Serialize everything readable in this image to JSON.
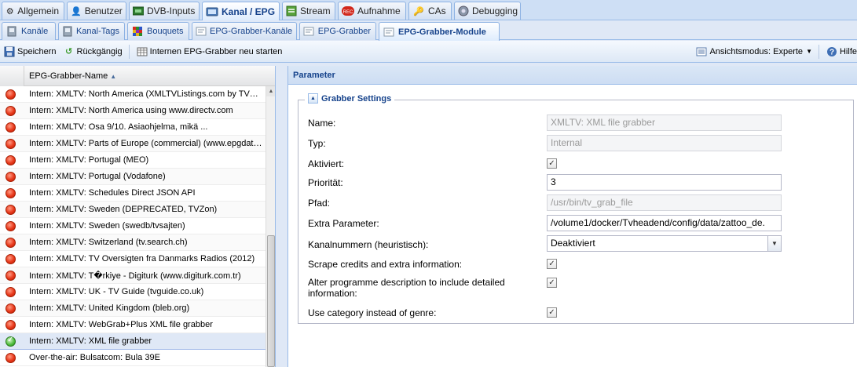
{
  "top_tabs": [
    {
      "label": "Allgemein",
      "icon": "gear-icon"
    },
    {
      "label": "Benutzer",
      "icon": "user-icon"
    },
    {
      "label": "DVB-Inputs",
      "icon": "dvb-card-icon"
    },
    {
      "label": "Kanal / EPG",
      "icon": "tv-icon",
      "active": true
    },
    {
      "label": "Stream",
      "icon": "stream-icon"
    },
    {
      "label": "Aufnahme",
      "icon": "record-icon"
    },
    {
      "label": "CAs",
      "icon": "key-icon"
    },
    {
      "label": "Debugging",
      "icon": "bug-icon"
    }
  ],
  "sub_tabs": [
    {
      "label": "Kanäle",
      "icon": "tv-small-icon"
    },
    {
      "label": "Kanal-Tags",
      "icon": "tag-icon"
    },
    {
      "label": "Bouquets",
      "icon": "bouquet-icon"
    },
    {
      "label": "EPG-Grabber-Kanäle",
      "icon": "epg-icon"
    },
    {
      "label": "EPG-Grabber",
      "icon": "epg-icon"
    },
    {
      "label": "EPG-Grabber-Module",
      "icon": "epg-icon",
      "active": true
    }
  ],
  "toolbar": {
    "save_label": "Speichern",
    "undo_label": "Rückgängig",
    "restart_label": "Internen EPG-Grabber neu starten",
    "view_mode_label": "Ansichtsmodus: Experte",
    "help_label": "Hilfe"
  },
  "grid": {
    "column_header": "EPG-Grabber-Name",
    "rows": [
      {
        "name": "Intern: XMLTV: North America (XMLTVListings.com by TVMedia)",
        "enabled": false
      },
      {
        "name": "Intern: XMLTV: North America using www.directv.com",
        "enabled": false
      },
      {
        "name": "Intern: XMLTV: Osa 9/10. Asiaohjelma, mikä ...",
        "enabled": false
      },
      {
        "name": "Intern: XMLTV: Parts of Europe (commercial) (www.epgdata.com)",
        "enabled": false
      },
      {
        "name": "Intern: XMLTV: Portugal (MEO)",
        "enabled": false
      },
      {
        "name": "Intern: XMLTV: Portugal (Vodafone)",
        "enabled": false
      },
      {
        "name": "Intern: XMLTV: Schedules Direct JSON API",
        "enabled": false
      },
      {
        "name": "Intern: XMLTV: Sweden (DEPRECATED, TVZon)",
        "enabled": false
      },
      {
        "name": "Intern: XMLTV: Sweden (swedb/tvsajten)",
        "enabled": false
      },
      {
        "name": "Intern: XMLTV: Switzerland (tv.search.ch)",
        "enabled": false
      },
      {
        "name": "Intern: XMLTV: TV Oversigten fra Danmarks Radios (2012)",
        "enabled": false
      },
      {
        "name": "Intern: XMLTV: T�rkiye - Digiturk (www.digiturk.com.tr)",
        "enabled": false
      },
      {
        "name": "Intern: XMLTV: UK - TV Guide (tvguide.co.uk)",
        "enabled": false
      },
      {
        "name": "Intern: XMLTV: United Kingdom (bleb.org)",
        "enabled": false
      },
      {
        "name": "Intern: XMLTV: WebGrab+Plus XML file grabber",
        "enabled": false
      },
      {
        "name": "Intern: XMLTV: XML file grabber",
        "enabled": true,
        "selected": true
      },
      {
        "name": "Over-the-air: Bulsatcom: Bula 39E",
        "enabled": false
      }
    ]
  },
  "panel": {
    "title": "Parameter",
    "section_title": "Grabber Settings",
    "fields": {
      "name": {
        "label": "Name:",
        "value": "XMLTV: XML file grabber"
      },
      "type": {
        "label": "Typ:",
        "value": "Internal"
      },
      "enabled": {
        "label": "Aktiviert:",
        "checked": true
      },
      "priority": {
        "label": "Priorität:",
        "value": "3"
      },
      "path": {
        "label": "Pfad:",
        "value": "/usr/bin/tv_grab_file"
      },
      "extra_params": {
        "label": "Extra Parameter:",
        "value": "/volume1/docker/Tvheadend/config/data/zattoo_de."
      },
      "channel_numbers": {
        "label": "Kanalnummern (heuristisch):",
        "value": "Deaktiviert"
      },
      "scrape_credits": {
        "label": "Scrape credits and extra information:",
        "checked": true
      },
      "alter_desc_line1": "Alter programme description to include detailed",
      "alter_desc_line2": "information:",
      "alter_desc": {
        "checked": true
      },
      "use_category": {
        "label": "Use category instead of genre:",
        "checked": true
      }
    }
  },
  "colors": {
    "accent": "#15428b",
    "border": "#99bbe8",
    "status_off": "#e8381a",
    "status_on": "#4cbb3a"
  }
}
